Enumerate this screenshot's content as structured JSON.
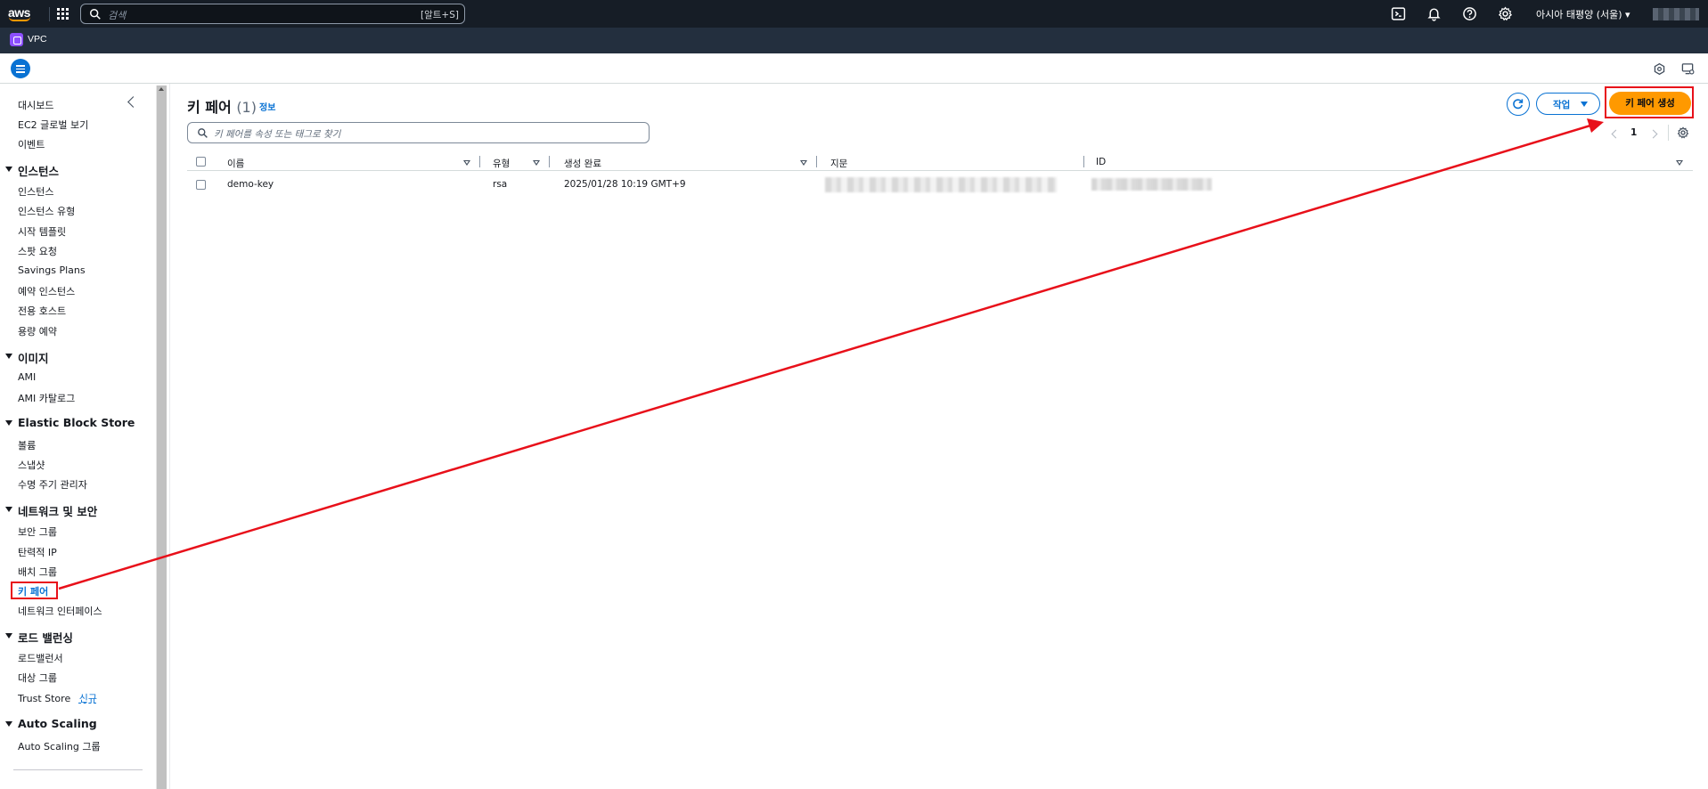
{
  "topnav": {
    "logo_text": "aws",
    "search_placeholder": "검색",
    "search_shortcut": "[알트+S]",
    "region": "아시아 태평양 (서울) ▾",
    "icons": [
      "cloudshell-icon",
      "bell-icon",
      "help-icon",
      "gear-icon"
    ]
  },
  "servicebar": {
    "service": "VPC"
  },
  "sidebar": {
    "top_items": [
      "대시보드",
      "EC2 글로벌 보기",
      "이벤트"
    ],
    "sections": [
      {
        "title": "인스턴스",
        "items": [
          "인스턴스",
          "인스턴스 유형",
          "시작 템플릿",
          "스팟 요청",
          "Savings Plans",
          "예약 인스턴스",
          "전용 호스트",
          "용량 예약"
        ]
      },
      {
        "title": "이미지",
        "items": [
          "AMI",
          "AMI 카탈로그"
        ]
      },
      {
        "title": "Elastic Block Store",
        "items": [
          "볼륨",
          "스냅샷",
          "수명 주기 관리자"
        ]
      },
      {
        "title": "네트워크 및 보안",
        "items": [
          "보안 그룹",
          "탄력적 IP",
          "배치 그룹",
          "키 페어",
          "네트워크 인터페이스"
        ]
      },
      {
        "title": "로드 밸런싱",
        "items": [
          "로드밸런서",
          "대상 그룹",
          "Trust Store"
        ]
      },
      {
        "title": "Auto Scaling",
        "items": [
          "Auto Scaling 그룹"
        ]
      }
    ],
    "new_badge": "신규",
    "active_item": "키 페어"
  },
  "main": {
    "title": "키 페어",
    "count": "(1)",
    "info_link": "정보",
    "filter_placeholder": "키 페어를 속성 또는 태그로 찾기",
    "action_button": "작업",
    "create_button": "키 페어 생성",
    "page_number": "1",
    "columns": [
      "이름",
      "유형",
      "생성 완료",
      "지문",
      "ID"
    ],
    "rows": [
      {
        "name": "demo-key",
        "type": "rsa",
        "created": "2025/01/28 10:19 GMT+9",
        "fingerprint": "",
        "id": ""
      }
    ]
  },
  "colors": {
    "accent": "#0972d3",
    "primary_button": "#ff9900",
    "annotation": "#e8101a",
    "topbar": "#161d26"
  }
}
